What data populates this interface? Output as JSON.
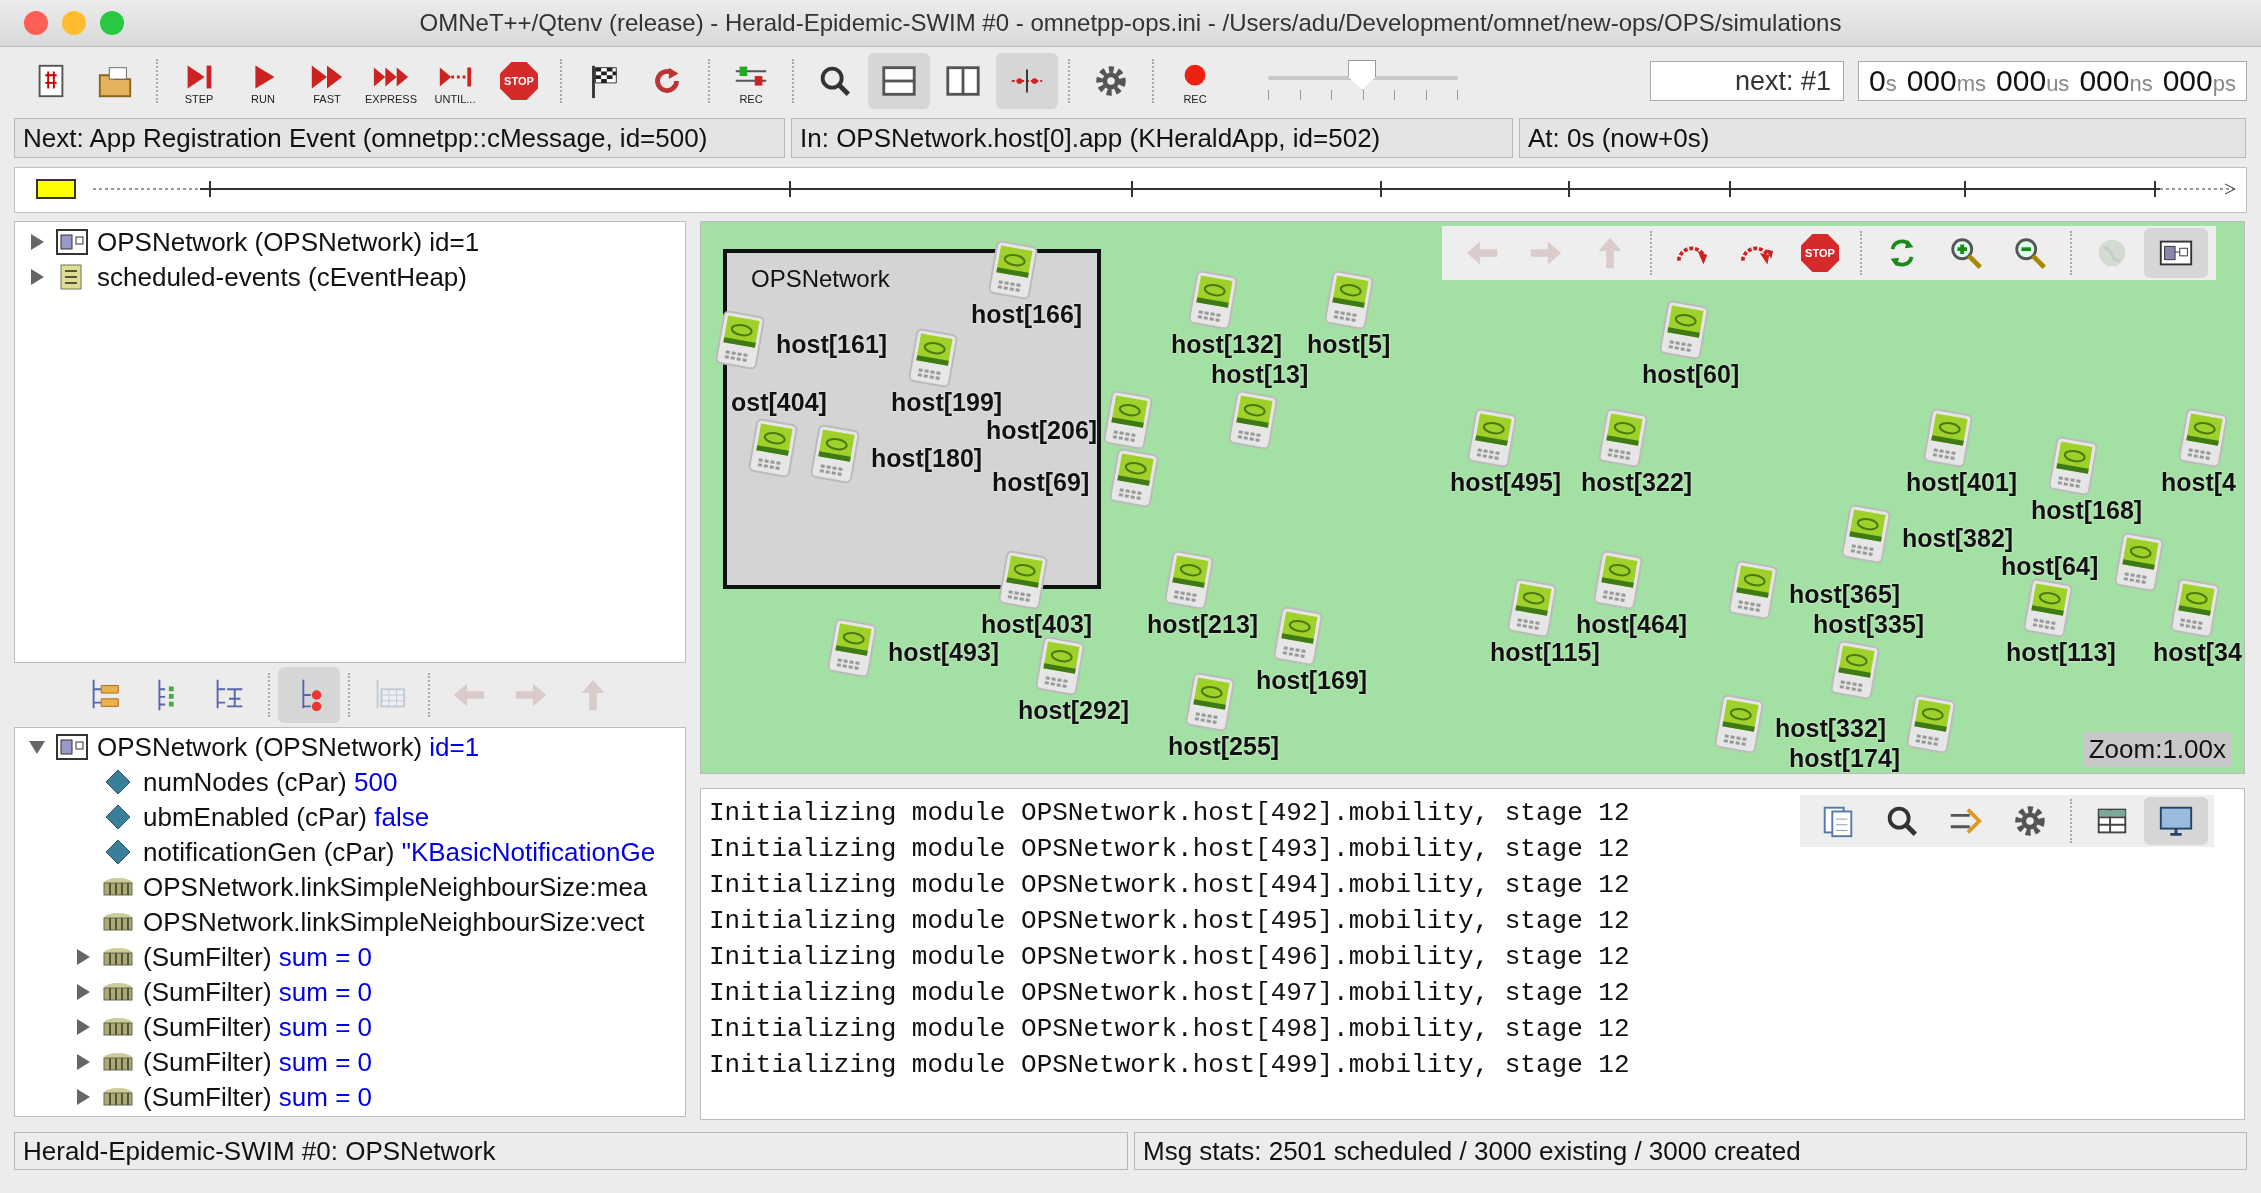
{
  "window": {
    "title": "OMNeT++/Qtenv (release) - Herald-Epidemic-SWIM #0 - omnetpp-ops.ini - /Users/adu/Development/omnet/new-ops/OPS/simulations"
  },
  "toolbar": {
    "groups": [
      [
        {
          "selected": false
        },
        {
          "selected": false
        }
      ],
      [
        {
          "label": "STEP",
          "selected": false
        },
        {
          "label": "RUN",
          "selected": false
        },
        {
          "label": "FAST",
          "selected": false
        },
        {
          "label": "EXPRESS",
          "selected": false
        },
        {
          "label": "UNTIL...",
          "selected": false
        },
        {
          "label": "STOP",
          "selected": false
        }
      ],
      [
        {
          "selected": false
        },
        {
          "selected": false
        }
      ],
      [
        {
          "label": "REC",
          "selected": false
        }
      ],
      [
        {
          "selected": false
        },
        {
          "selected": true
        },
        {
          "selected": false
        },
        {
          "selected": true
        }
      ],
      [
        {
          "selected": false
        }
      ],
      [
        {
          "label": "REC",
          "selected": false
        }
      ]
    ],
    "speed_slider": {
      "level": 0.49
    },
    "next_event": "next: #1",
    "sim_time": [
      {
        "value": "0",
        "unit": "s"
      },
      {
        "value": "000",
        "unit": "ms"
      },
      {
        "value": "000",
        "unit": "us"
      },
      {
        "value": "000",
        "unit": "ns"
      },
      {
        "value": "000",
        "unit": "ps"
      }
    ]
  },
  "info_bar": [
    "Next: App Registration Event (omnetpp::cMessage, id=500)",
    "In: OPSNetwork.host[0].app (KHeraldApp, id=502)",
    "At: 0s (now+0s)"
  ],
  "object_tree": [
    {
      "label": "OPSNetwork (OPSNetwork) id=1",
      "kind": "module",
      "expandable": true,
      "expanded": false
    },
    {
      "label": "scheduled-events (cEventHeap)",
      "kind": "heap",
      "expandable": true,
      "expanded": false
    }
  ],
  "inspector_toolbar": {
    "groups": [
      [
        {
          "selected": false,
          "disabled": false
        },
        {
          "selected": false,
          "disabled": false
        },
        {
          "selected": false,
          "disabled": false
        }
      ],
      [
        {
          "selected": true,
          "disabled": false
        }
      ],
      [
        {
          "selected": false,
          "disabled": true
        }
      ],
      [
        {
          "selected": false,
          "disabled": true
        },
        {
          "selected": false,
          "disabled": true
        },
        {
          "selected": false,
          "disabled": true
        }
      ]
    ]
  },
  "inspector_tree": [
    {
      "label": "OPSNetwork (OPSNetwork)",
      "value": "id=1",
      "kind": "module",
      "expandable": true,
      "expanded": true,
      "children": [
        {
          "label": "numNodes (cPar)",
          "value": "500",
          "kind": "param",
          "expandable": false,
          "expanded": false
        },
        {
          "label": "ubmEnabled (cPar)",
          "value": "false",
          "kind": "param",
          "expandable": false,
          "expanded": false
        },
        {
          "label": "notificationGen (cPar)",
          "value": "\"KBasicNotificationGe",
          "kind": "param",
          "expandable": false,
          "expanded": false
        },
        {
          "label": "OPSNetwork.linkSimpleNeighbourSize:mea",
          "kind": "stat",
          "expandable": false,
          "expanded": false
        },
        {
          "label": "OPSNetwork.linkSimpleNeighbourSize:vect",
          "kind": "stat",
          "expandable": false,
          "expanded": false
        },
        {
          "label": "(SumFilter)",
          "value": "sum = 0",
          "kind": "stat",
          "expandable": true,
          "expanded": false
        },
        {
          "label": "(SumFilter)",
          "value": "sum = 0",
          "kind": "stat",
          "expandable": true,
          "expanded": false
        },
        {
          "label": "(SumFilter)",
          "value": "sum = 0",
          "kind": "stat",
          "expandable": true,
          "expanded": false
        },
        {
          "label": "(SumFilter)",
          "value": "sum = 0",
          "kind": "stat",
          "expandable": true,
          "expanded": false
        },
        {
          "label": "(SumFilter)",
          "value": "sum = 0",
          "kind": "stat",
          "expandable": true,
          "expanded": false
        }
      ]
    }
  ],
  "network": {
    "title": "OPSNetwork",
    "zoom": "Zoom:1.00x",
    "toolbar": {
      "groups": [
        [
          {
            "selected": false,
            "disabled": true
          },
          {
            "selected": false,
            "disabled": true
          },
          {
            "selected": false,
            "disabled": true
          }
        ],
        [
          {
            "selected": false,
            "disabled": false
          },
          {
            "selected": false,
            "disabled": false
          },
          {
            "label": "STOP",
            "selected": false,
            "disabled": false
          }
        ],
        [
          {
            "selected": false,
            "disabled": false
          },
          {
            "selected": false,
            "disabled": false
          },
          {
            "selected": false,
            "disabled": false
          }
        ],
        [
          {
            "selected": false,
            "disabled": true
          },
          {
            "selected": true,
            "disabled": false
          }
        ]
      ]
    },
    "hosts": [
      {
        "label": "host[166]"
      },
      {
        "label": "host[161]"
      },
      {
        "label": "host[132]"
      },
      {
        "label": "host[5]"
      },
      {
        "label": "host[13]"
      },
      {
        "label": "host[60]"
      },
      {
        "label": "ost[404]"
      },
      {
        "label": "host[199]"
      },
      {
        "label": "host[206]"
      },
      {
        "label": "host[180]"
      },
      {
        "label": "host[69]"
      },
      {
        "label": "host[495]"
      },
      {
        "label": "host[322]"
      },
      {
        "label": "host[401]"
      },
      {
        "label": "host[4"
      },
      {
        "label": "host[168]"
      },
      {
        "label": "host[382]"
      },
      {
        "label": "host[64]"
      },
      {
        "label": "host[365]"
      },
      {
        "label": "host[403]"
      },
      {
        "label": "host[213]"
      },
      {
        "label": "host[464]"
      },
      {
        "label": "host[335]"
      },
      {
        "label": "host[493]"
      },
      {
        "label": "host[115]"
      },
      {
        "label": "host[113]"
      },
      {
        "label": "host[34"
      },
      {
        "label": "host[169]"
      },
      {
        "label": "host[292]"
      },
      {
        "label": "host[332]"
      },
      {
        "label": "host[255]"
      },
      {
        "label": "host[174]"
      }
    ]
  },
  "log": {
    "toolbar": {
      "groups": [
        [
          {
            "selected": false
          },
          {
            "selected": false
          },
          {
            "selected": false
          },
          {
            "selected": false
          }
        ],
        [
          {
            "selected": false
          },
          {
            "selected": true
          }
        ]
      ]
    },
    "lines": [
      "Initializing module OPSNetwork.host[492].mobility, stage 12",
      "Initializing module OPSNetwork.host[493].mobility, stage 12",
      "Initializing module OPSNetwork.host[494].mobility, stage 12",
      "Initializing module OPSNetwork.host[495].mobility, stage 12",
      "Initializing module OPSNetwork.host[496].mobility, stage 12",
      "Initializing module OPSNetwork.host[497].mobility, stage 12",
      "Initializing module OPSNetwork.host[498].mobility, stage 12",
      "Initializing module OPSNetwork.host[499].mobility, stage 12"
    ]
  },
  "status_bar": [
    "Herald-Epidemic-SWIM #0: OPSNetwork",
    "Msg stats: 2501 scheduled / 3000 existing / 3000 created"
  ]
}
